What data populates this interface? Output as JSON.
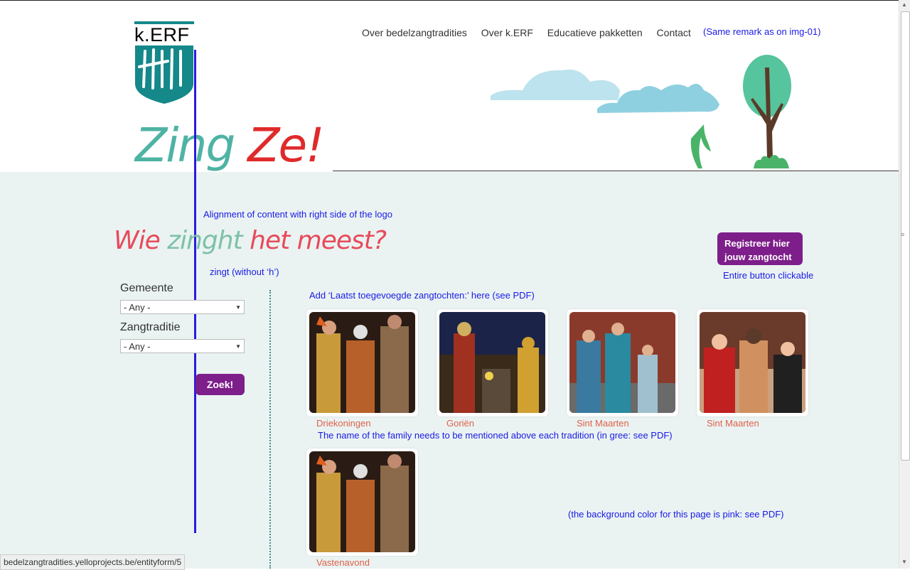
{
  "brand": {
    "logo_text": "k.ERF",
    "title_part1": "Zing",
    "title_part2": "Ze!"
  },
  "nav": {
    "items": [
      "Over bedelzangtradities",
      "Over k.ERF",
      "Educatieve pakketten",
      "Contact"
    ]
  },
  "notes": {
    "nav_remark": "(Same remark as on img-01)",
    "alignment": "Alignment of content with right side of the logo",
    "zingt": "zingt (without ‘h’)",
    "button": "Entire button clickable",
    "latest": "Add ‘Laatst toegevoegde zangtochten:’ here (see PDF)",
    "family": "The name of the family needs to be mentioned above each tradition (in gree: see PDF)",
    "background": "(the background color for this page is pink: see PDF)"
  },
  "subtitle": {
    "part1": "Wie",
    "part2": "zinght",
    "part3": "het meest?"
  },
  "register_button": {
    "line1": "Registreer hier",
    "line2": "jouw zangtocht"
  },
  "filters": {
    "gemeente_label": "Gemeente",
    "gemeente_value": "- Any -",
    "zangtraditie_label": "Zangtraditie",
    "zangtraditie_value": "- Any -",
    "submit_label": "Zoek!"
  },
  "cards": [
    {
      "label": "Driekoningen"
    },
    {
      "label": "Goriën"
    },
    {
      "label": "Sint Maarten"
    },
    {
      "label": "Sint Maarten"
    },
    {
      "label": "Vastenavond"
    }
  ],
  "status_bar": "bedelzangtradities.yelloprojects.be/entityform/5",
  "colors": {
    "accent_purple": "#7d1e8a",
    "teal": "#15888a",
    "red": "#e02a2a",
    "note_blue": "#1a1ae6"
  }
}
